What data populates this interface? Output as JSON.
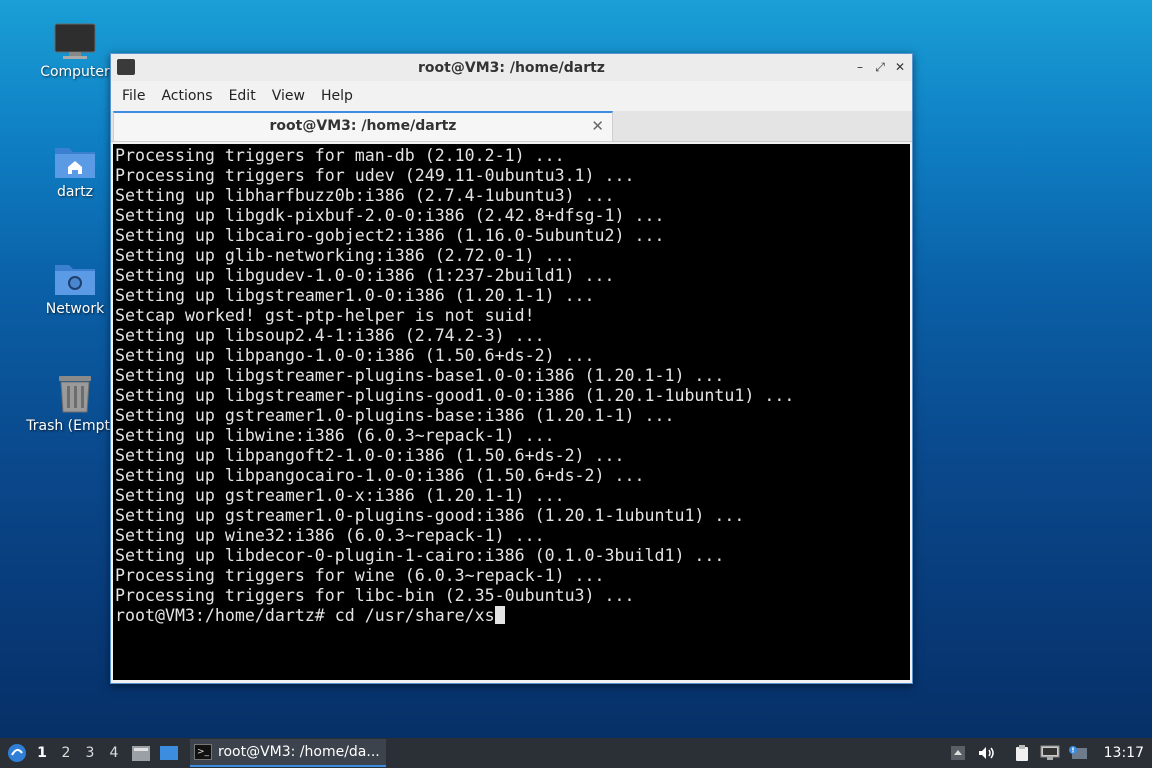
{
  "desktop": {
    "icons": [
      {
        "label": "Computer",
        "icon": "monitor-icon"
      },
      {
        "label": "dartz",
        "icon": "home-folder-icon"
      },
      {
        "label": "Network",
        "icon": "network-folder-icon"
      },
      {
        "label": "Trash (Empty)",
        "icon": "trash-icon"
      }
    ]
  },
  "window": {
    "title": "root@VM3: /home/dartz",
    "controls": {
      "minimize": "–",
      "maximize": "⤢",
      "close": "✕"
    },
    "menu": [
      "File",
      "Actions",
      "Edit",
      "View",
      "Help"
    ],
    "tab": {
      "label": "root@VM3: /home/dartz",
      "close": "✕"
    }
  },
  "terminal": {
    "lines": [
      "Processing triggers for man-db (2.10.2-1) ...",
      "Processing triggers for udev (249.11-0ubuntu3.1) ...",
      "Setting up libharfbuzz0b:i386 (2.7.4-1ubuntu3) ...",
      "Setting up libgdk-pixbuf-2.0-0:i386 (2.42.8+dfsg-1) ...",
      "Setting up libcairo-gobject2:i386 (1.16.0-5ubuntu2) ...",
      "Setting up glib-networking:i386 (2.72.0-1) ...",
      "Setting up libgudev-1.0-0:i386 (1:237-2build1) ...",
      "Setting up libgstreamer1.0-0:i386 (1.20.1-1) ...",
      "Setcap worked! gst-ptp-helper is not suid!",
      "Setting up libsoup2.4-1:i386 (2.74.2-3) ...",
      "Setting up libpango-1.0-0:i386 (1.50.6+ds-2) ...",
      "Setting up libgstreamer-plugins-base1.0-0:i386 (1.20.1-1) ...",
      "Setting up libgstreamer-plugins-good1.0-0:i386 (1.20.1-1ubuntu1) ...",
      "Setting up gstreamer1.0-plugins-base:i386 (1.20.1-1) ...",
      "Setting up libwine:i386 (6.0.3~repack-1) ...",
      "Setting up libpangoft2-1.0-0:i386 (1.50.6+ds-2) ...",
      "Setting up libpangocairo-1.0-0:i386 (1.50.6+ds-2) ...",
      "Setting up gstreamer1.0-x:i386 (1.20.1-1) ...",
      "Setting up gstreamer1.0-plugins-good:i386 (1.20.1-1ubuntu1) ...",
      "Setting up wine32:i386 (6.0.3~repack-1) ...",
      "Setting up libdecor-0-plugin-1-cairo:i386 (0.1.0-3build1) ...",
      "Processing triggers for wine (6.0.3~repack-1) ...",
      "Processing triggers for libc-bin (2.35-0ubuntu3) ..."
    ],
    "prompt": "root@VM3:/home/dartz# ",
    "input": "cd /usr/share/xs"
  },
  "taskbar": {
    "workspaces": [
      "1",
      "2",
      "3",
      "4"
    ],
    "active_workspace": "1",
    "task_label": "root@VM3: /home/da...",
    "clock": "13:17"
  },
  "colors": {
    "accent": "#3c8ce0",
    "terminal_bg": "#000000",
    "terminal_fg": "#e4e4e4",
    "taskbar_bg": "#2b2f36"
  }
}
